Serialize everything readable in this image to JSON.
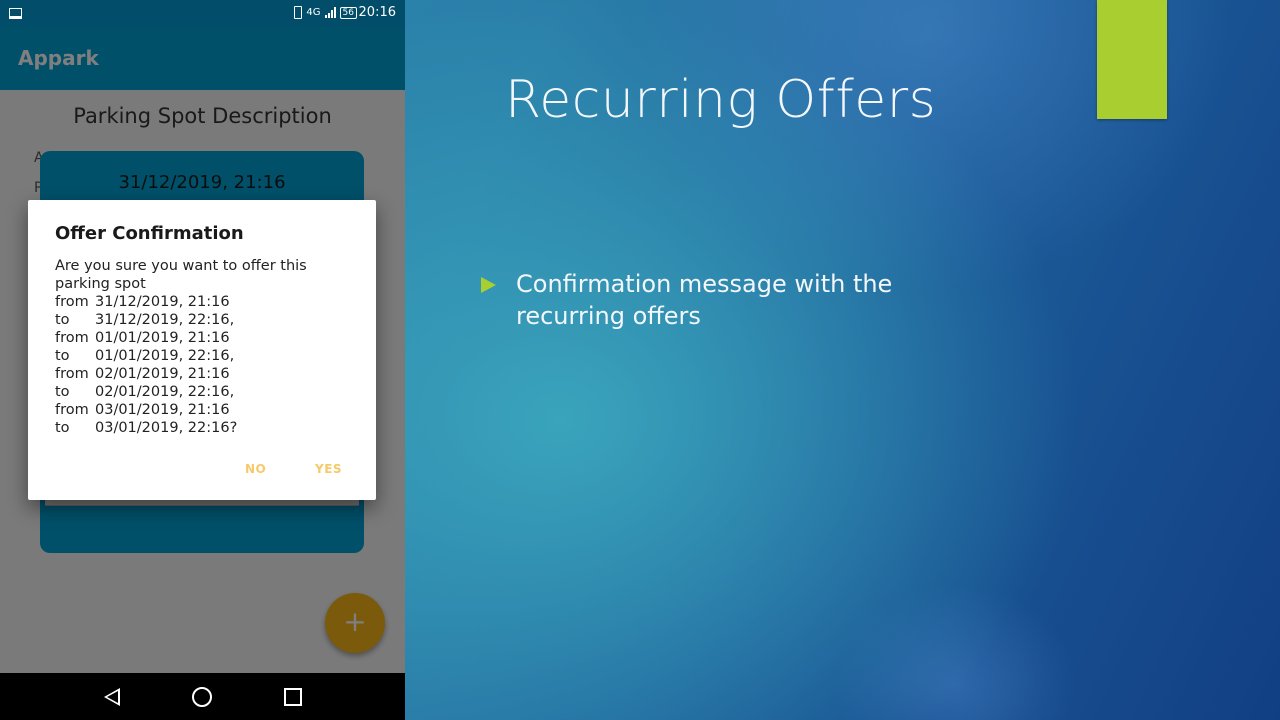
{
  "colors": {
    "slide_accent": "#a8cf2f",
    "app_primary": "#03a0d4",
    "status_bar": "#014d6a",
    "fab": "#f6b417",
    "dialog_button": "#f6c96a"
  },
  "status_bar": {
    "network": "4G",
    "battery": "56",
    "time": "20:16"
  },
  "app": {
    "title": "Appark",
    "page_heading": "Parking Spot Description",
    "side_label_a": "A",
    "side_label_p": "P",
    "card_date": "31/12/2019, 21:16",
    "fab_label": "+"
  },
  "dialog": {
    "title": "Offer Confirmation",
    "intro": "Are you sure you want to offer this parking spot",
    "schedule": [
      {
        "k": "from",
        "v": "31/12/2019, 21:16"
      },
      {
        "k": "to",
        "v": "31/12/2019, 22:16,"
      },
      {
        "k": "from",
        "v": "01/01/2019, 21:16"
      },
      {
        "k": "to",
        "v": "01/01/2019, 22:16,"
      },
      {
        "k": "from",
        "v": "02/01/2019, 21:16"
      },
      {
        "k": "to",
        "v": "02/01/2019, 22:16,"
      },
      {
        "k": "from",
        "v": "03/01/2019, 21:16"
      },
      {
        "k": "to",
        "v": "03/01/2019, 22:16?"
      }
    ],
    "no_label": "NO",
    "yes_label": "YES"
  },
  "nav": {
    "back_icon": "triangle-back-icon",
    "home_icon": "circle-home-icon",
    "recent_icon": "square-recents-icon"
  },
  "slide": {
    "title": "Recurring Offers",
    "bullets": [
      "Confirmation message with the recurring offers"
    ]
  }
}
